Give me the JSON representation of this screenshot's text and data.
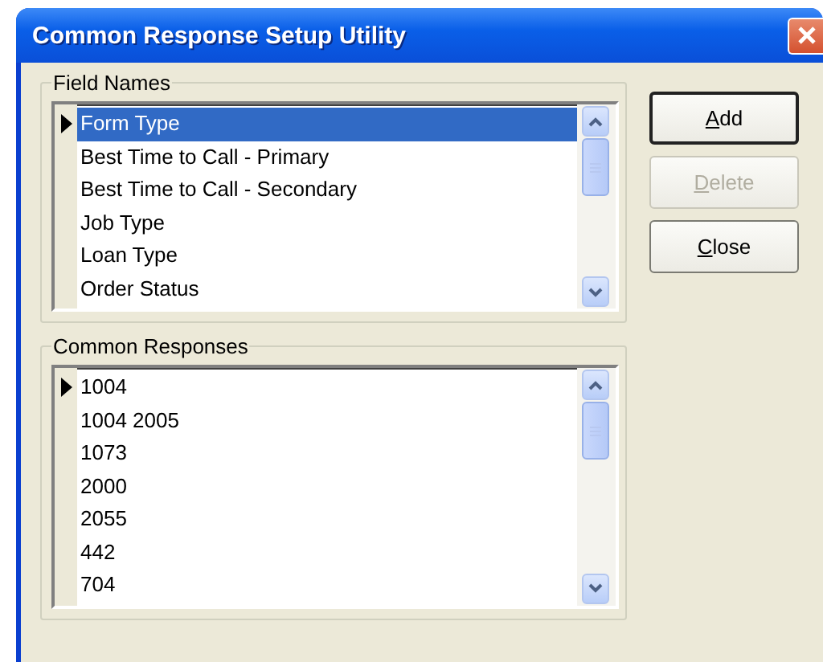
{
  "window": {
    "title": "Common Response Setup Utility"
  },
  "groups": [
    {
      "label": "Field Names",
      "items": [
        {
          "text": "Form Type",
          "selected": true,
          "current": true
        },
        {
          "text": "Best Time to Call - Primary",
          "selected": false,
          "current": false
        },
        {
          "text": "Best Time to Call - Secondary",
          "selected": false,
          "current": false
        },
        {
          "text": "Job Type",
          "selected": false,
          "current": false
        },
        {
          "text": "Loan Type",
          "selected": false,
          "current": false
        },
        {
          "text": "Order Status",
          "selected": false,
          "current": false
        }
      ]
    },
    {
      "label": "Common Responses",
      "items": [
        {
          "text": "1004",
          "selected": false,
          "current": true
        },
        {
          "text": "1004 2005",
          "selected": false,
          "current": false
        },
        {
          "text": "1073",
          "selected": false,
          "current": false
        },
        {
          "text": "2000",
          "selected": false,
          "current": false
        },
        {
          "text": "2055",
          "selected": false,
          "current": false
        },
        {
          "text": "442",
          "selected": false,
          "current": false
        },
        {
          "text": "704",
          "selected": false,
          "current": false
        }
      ]
    }
  ],
  "buttons": [
    {
      "label": "Add",
      "disabled": false,
      "default": true,
      "underline_first": true
    },
    {
      "label": "Delete",
      "disabled": true,
      "default": false,
      "underline_first": true
    },
    {
      "label": "Close",
      "disabled": false,
      "default": false,
      "underline_first": true
    }
  ]
}
